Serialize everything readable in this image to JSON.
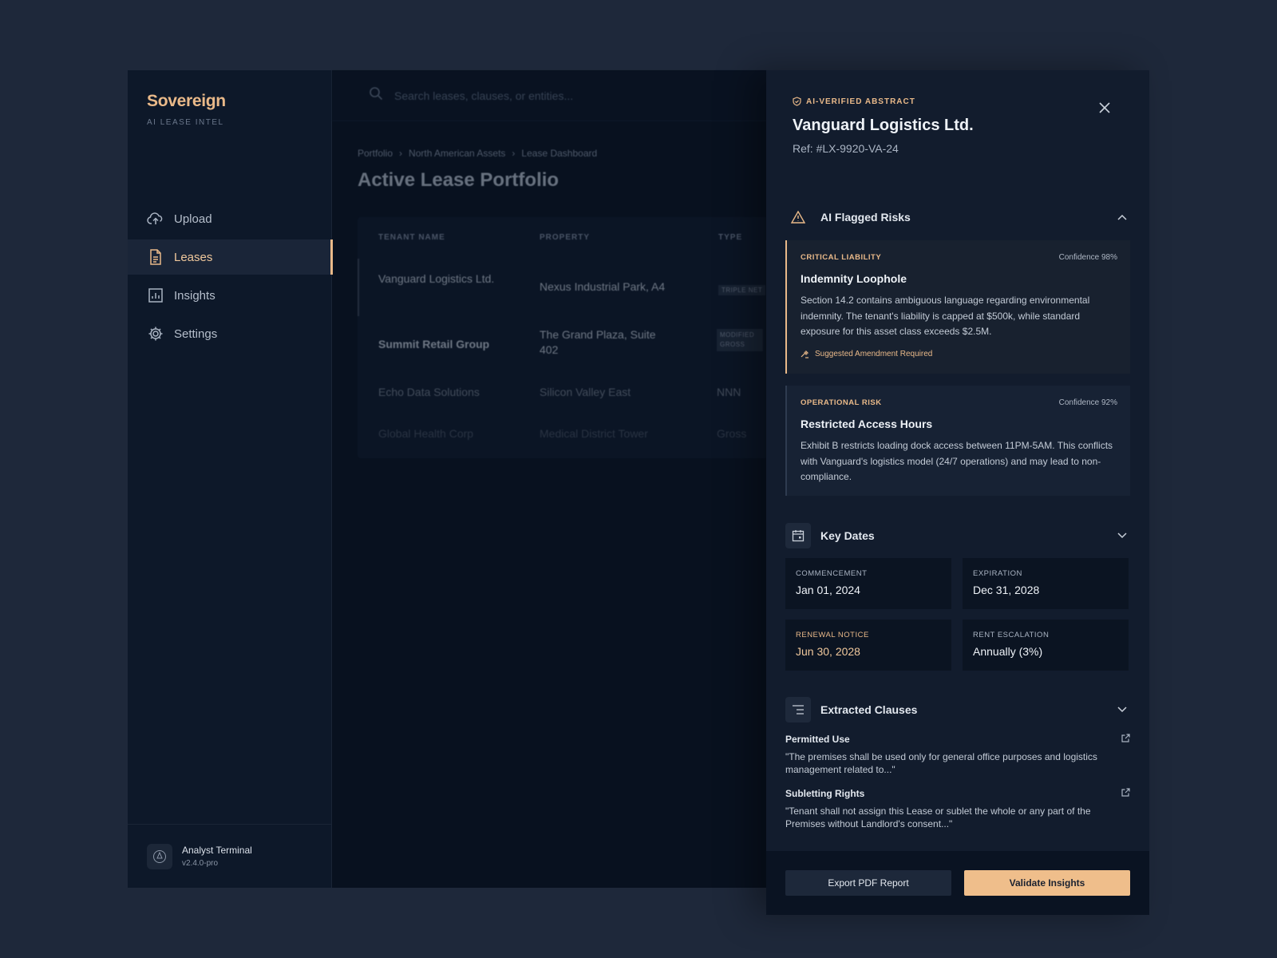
{
  "brand": {
    "name": "Sovereign",
    "subtitle": "AI LEASE INTEL"
  },
  "nav": [
    {
      "label": "Upload",
      "icon": "cloud-upload-icon",
      "active": false
    },
    {
      "label": "Leases",
      "icon": "document-icon",
      "active": true
    },
    {
      "label": "Insights",
      "icon": "bar-chart-icon",
      "active": false
    },
    {
      "label": "Settings",
      "icon": "gear-icon",
      "active": false
    }
  ],
  "user": {
    "name": "Analyst Terminal",
    "version": "v2.4.0-pro"
  },
  "search": {
    "placeholder": "Search leases, clauses, or entities..."
  },
  "breadcrumb": [
    "Portfolio",
    "North American Assets",
    "Lease Dashboard"
  ],
  "page_title": "Active Lease Portfolio",
  "table": {
    "headers": [
      "TENANT NAME",
      "PROPERTY",
      "TYPE"
    ],
    "rows": [
      {
        "tenant": "Vanguard Logistics Ltd.",
        "property": "Nexus Industrial Park, A4",
        "type": "TRIPLE NET"
      },
      {
        "tenant": "Summit Retail Group",
        "property": "The Grand Plaza, Suite 402",
        "type": "MODIFIED GROSS"
      },
      {
        "tenant": "Echo Data Solutions",
        "property": "Silicon Valley East",
        "type": "NNN"
      },
      {
        "tenant": "Global Health Corp",
        "property": "Medical District Tower",
        "type": "Gross"
      }
    ]
  },
  "drawer": {
    "badge": "AI-VERIFIED ABSTRACT",
    "title": "Vanguard Logistics Ltd.",
    "ref": "Ref: #LX-9920-VA-24",
    "risks_title": "AI Flagged Risks",
    "risks": [
      {
        "category": "CRITICAL LIABILITY",
        "confidence": "Confidence 98%",
        "title": "Indemnity Loophole",
        "body": "Section 14.2 contains ambiguous language regarding environmental indemnity. The tenant's liability is capped at $500k, while standard exposure for this asset class exceeds $2.5M.",
        "note": "Suggested Amendment Required"
      },
      {
        "category": "OPERATIONAL RISK",
        "confidence": "Confidence 92%",
        "title": "Restricted Access Hours",
        "body": "Exhibit B restricts loading dock access between 11PM-5AM. This conflicts with Vanguard's logistics model (24/7 operations) and may lead to non-compliance."
      }
    ],
    "dates_title": "Key Dates",
    "dates": [
      {
        "label": "COMMENCEMENT",
        "value": "Jan 01, 2024"
      },
      {
        "label": "EXPIRATION",
        "value": "Dec 31, 2028"
      },
      {
        "label": "RENEWAL NOTICE",
        "value": "Jun 30, 2028"
      },
      {
        "label": "RENT ESCALATION",
        "value": "Annually (3%)"
      }
    ],
    "clauses_title": "Extracted Clauses",
    "clauses": [
      {
        "name": "Permitted Use",
        "text": "\"The premises shall be used only for general office purposes and logistics management related to...\""
      },
      {
        "name": "Subletting Rights",
        "text": "\"Tenant shall not assign this Lease or sublet the whole or any part of the Premises without Landlord's consent...\""
      }
    ],
    "export_label": "Export PDF Report",
    "validate_label": "Validate Insights"
  },
  "colors": {
    "accent": "#e9b989",
    "background": "#1e283a",
    "panel": "#121c2d"
  }
}
